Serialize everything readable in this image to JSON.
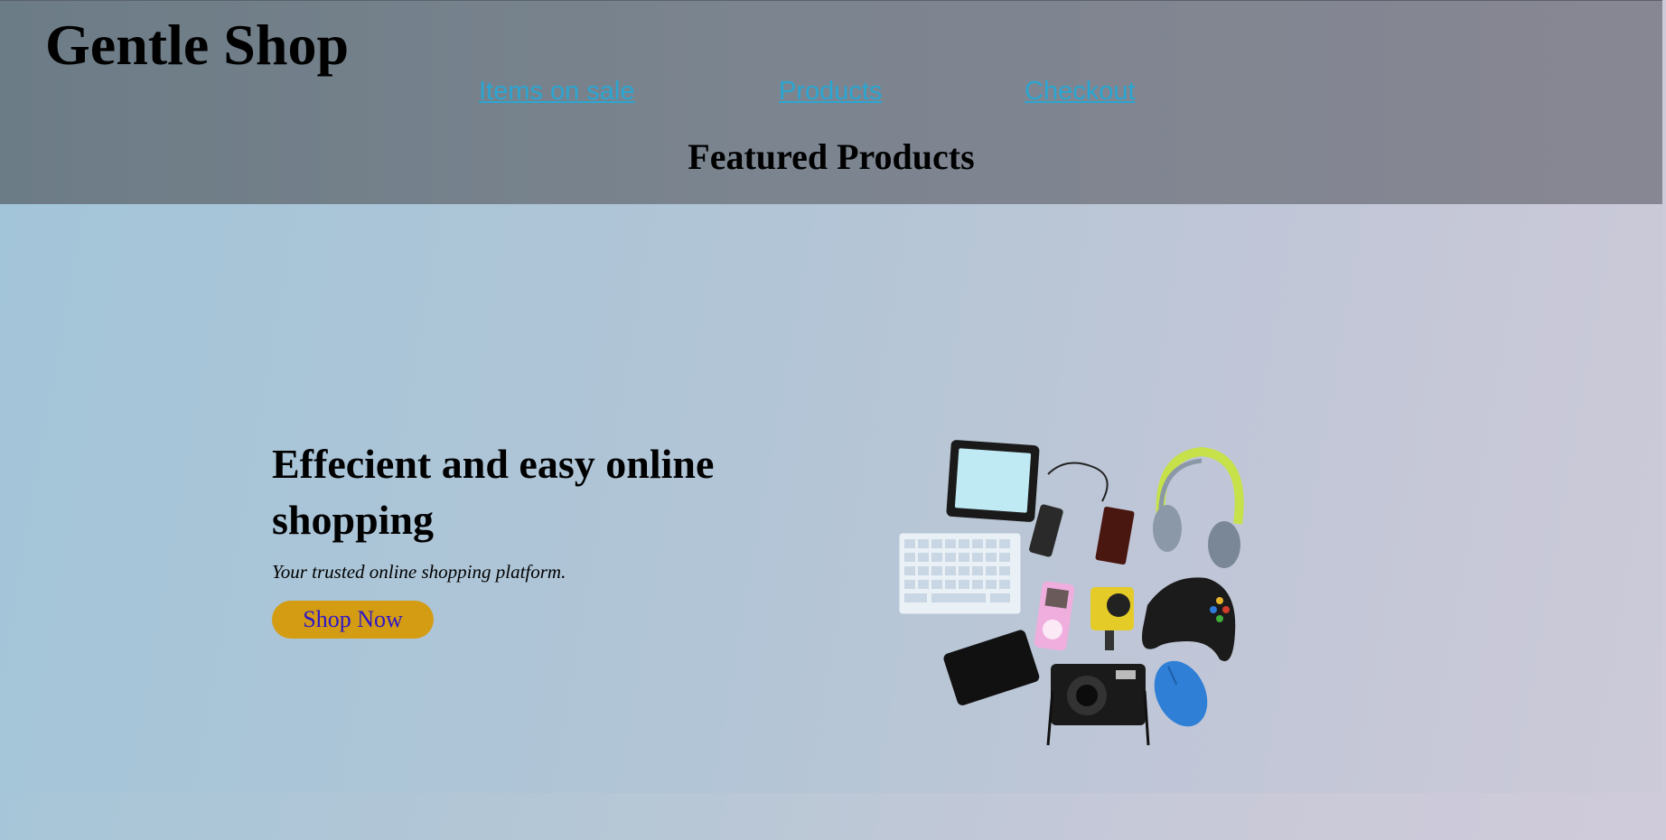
{
  "header": {
    "brand": "Gentle Shop",
    "nav": [
      {
        "label": "Items on sale"
      },
      {
        "label": "Products"
      },
      {
        "label": "Checkout"
      }
    ],
    "section_title": "Featured Products"
  },
  "hero": {
    "title": "Effecient and easy online shopping",
    "subtitle": "Your trusted online shopping platform.",
    "cta_label": "Shop Now",
    "image_icon": "electronics-collage-image"
  },
  "colors": {
    "header_bg": "#7b848f",
    "link": "#2aa6d2",
    "button_bg": "#d49c13",
    "button_text": "#2d16c8"
  }
}
